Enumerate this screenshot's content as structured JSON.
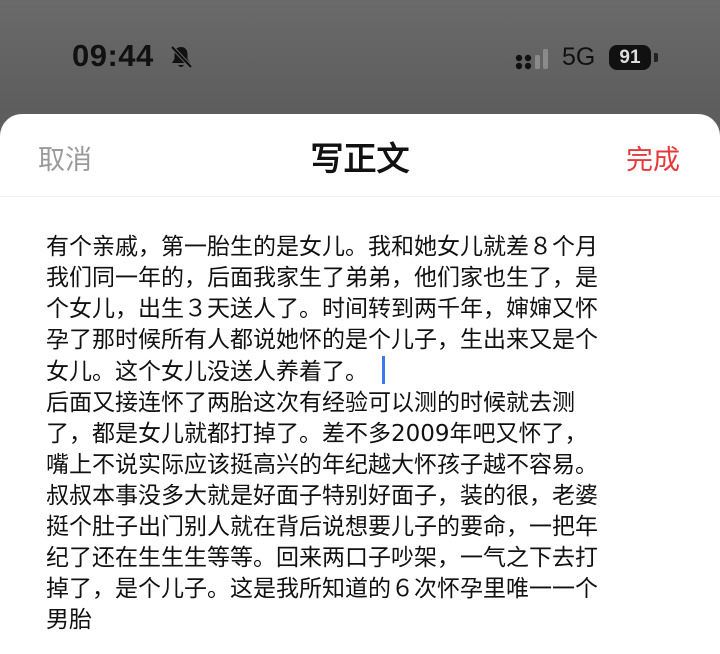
{
  "status_bar": {
    "time": "09:44",
    "silent_icon": "bell-slash-icon",
    "signal_icon": "cellular-signal-icon",
    "network": "5G",
    "battery": "91"
  },
  "header": {
    "cancel_label": "取消",
    "title": "写正文",
    "done_label": "完成"
  },
  "colors": {
    "accent_done": "#e5393b",
    "cursor": "#3a78f2"
  },
  "editor": {
    "before_cursor": "有个亲戚，第一胎生的是女儿。我和她女儿就差８个月\n我们同一年的，后面我家生了弟弟，他们家也生了，是\n个女儿，出生３天送人了。时间转到两千年，婶婶又怀\n孕了那时候所有人都说她怀的是个儿子，生出来又是个\n女儿。这个女儿没送人养着了。",
    "after_cursor": "\n后面又接连怀了两胎这次有经验可以测的时候就去测\n了，都是女儿就都打掉了。差不多2009年吧又怀了，\n嘴上不说实际应该挺高兴的年纪越大怀孩子越不容易。\n叔叔本事没多大就是好面子特别好面子，装的很，老婆\n挺个肚子出门别人就在背后说想要儿子的要命，一把年\n纪了还在生生生等等。回来两口子吵架，一气之下去打\n掉了，是个儿子。这是我所知道的６次怀孕里唯一一个\n男胎"
  }
}
